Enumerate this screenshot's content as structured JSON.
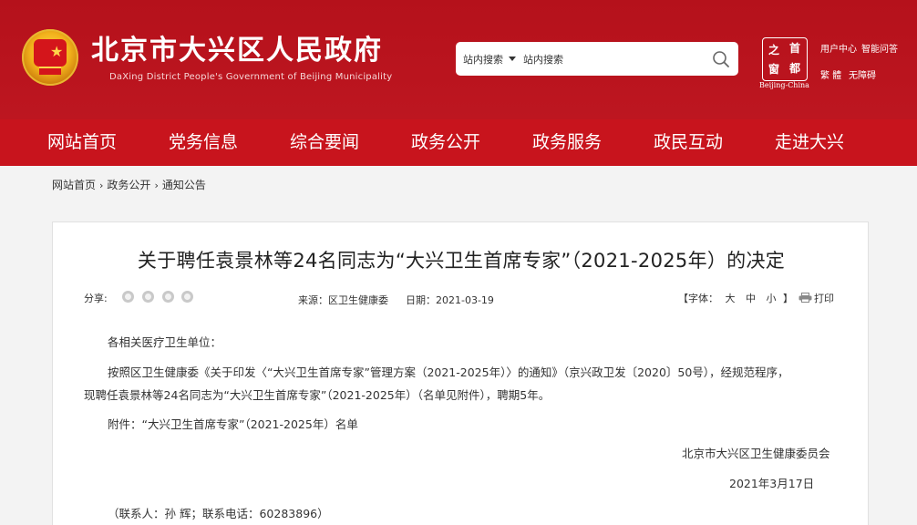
{
  "header": {
    "site_title": "北京市大兴区人民政府",
    "site_subtitle": "DaXing District People's Government of Beijing Municipality",
    "search": {
      "scope": "站内搜索",
      "placeholder": "站内搜索"
    },
    "capital_logo": {
      "chars": [
        "之",
        "首",
        "窗",
        "都"
      ],
      "caption": "Beijing-China"
    },
    "links": [
      "用户中心",
      "智能问答",
      "繁 體",
      "无障碍"
    ]
  },
  "nav": [
    "网站首页",
    "党务信息",
    "综合要闻",
    "政务公开",
    "政务服务",
    "政民互动",
    "走进大兴"
  ],
  "breadcrumb": [
    "网站首页",
    "政务公开",
    "通知公告"
  ],
  "article": {
    "title": "关于聘任袁景林等24名同志为“大兴卫生首席专家”（2021-2025年）的决定",
    "share_label": "分享:",
    "source": "来源：区卫生健康委",
    "date": "日期：2021-03-19",
    "font_size": {
      "label": "【字体：",
      "large": "大",
      "medium": "中",
      "small": "小",
      "close": "】"
    },
    "print_label": "打印",
    "salutation": "各相关医疗卫生单位：",
    "paragraph_line1": "按照区卫生健康委《关于印发〈“大兴卫生首席专家”管理方案（2021-2025年）〉的通知》（京兴政卫发〔2020〕50号），经规范程序，",
    "paragraph_line2": "现聘任袁景林等24名同志为“大兴卫生首席专家”（2021-2025年）（名单见附件），聘期5年。",
    "attachment": "附件：“大兴卫生首席专家”（2021-2025年）名单",
    "signature": "北京市大兴区卫生健康委员会",
    "sign_date": "2021年3月17日",
    "contact": "（联系人：孙 辉；联系电话：60283896）"
  },
  "colors": {
    "brand_red": "#b8101a",
    "nav_red": "#c8141d",
    "gold": "#f2b21c"
  }
}
